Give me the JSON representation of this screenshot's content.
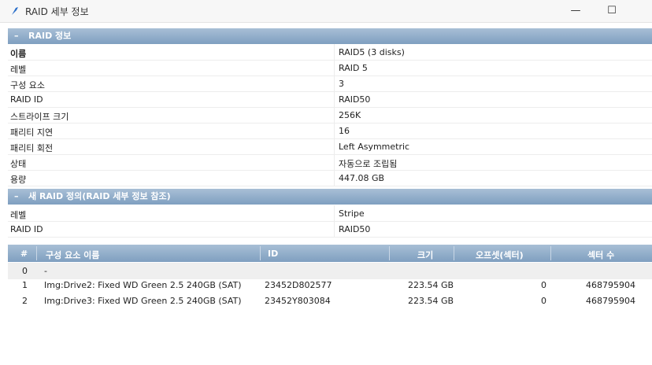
{
  "window": {
    "title": "RAID 세부 정보",
    "minimize_glyph": "—",
    "maximize_glyph": "☐"
  },
  "sections": {
    "raid_info": {
      "toggle": "–",
      "title": "RAID 정보"
    },
    "new_raid": {
      "toggle": "–",
      "title": "새 RAID 정의(RAID 세부 정보 참조)"
    }
  },
  "raid_info_rows": [
    {
      "key": "이름",
      "value": "RAID5 (3 disks)"
    },
    {
      "key": "레벨",
      "value": "RAID 5"
    },
    {
      "key": "구성 요소",
      "value": "3"
    },
    {
      "key": "RAID ID",
      "value": "RAID50"
    },
    {
      "key": "스트라이프 크기",
      "value": "256K"
    },
    {
      "key": "패리티 지연",
      "value": "16"
    },
    {
      "key": "패리티 회전",
      "value": "Left Asymmetric"
    },
    {
      "key": "상태",
      "value": "자동으로 조립됨"
    },
    {
      "key": "용량",
      "value": "447.08 GB"
    }
  ],
  "new_raid_rows": [
    {
      "key": "레벨",
      "value": "Stripe"
    },
    {
      "key": "RAID ID",
      "value": "RAID50"
    }
  ],
  "table": {
    "headers": {
      "num": "#",
      "name": "구성 요소 이름",
      "id": "ID",
      "size": "크기",
      "offset": "오프셋(섹터)",
      "sectors": "섹터 수"
    },
    "rows": [
      {
        "num": "0",
        "name": "-",
        "id": "",
        "size": "",
        "offset": "",
        "sectors": ""
      },
      {
        "num": "1",
        "name": "Img:Drive2: Fixed WD Green 2.5 240GB (SAT)",
        "id": "23452D802577",
        "size": "223.54 GB",
        "offset": "0",
        "sectors": "468795904"
      },
      {
        "num": "2",
        "name": "Img:Drive3: Fixed WD Green 2.5 240GB (SAT)",
        "id": "23452Y803084",
        "size": "223.54 GB",
        "offset": "0",
        "sectors": "468795904"
      }
    ]
  },
  "colors": {
    "header_blue": "#8aa8c8",
    "row_alt": "#efefef"
  }
}
